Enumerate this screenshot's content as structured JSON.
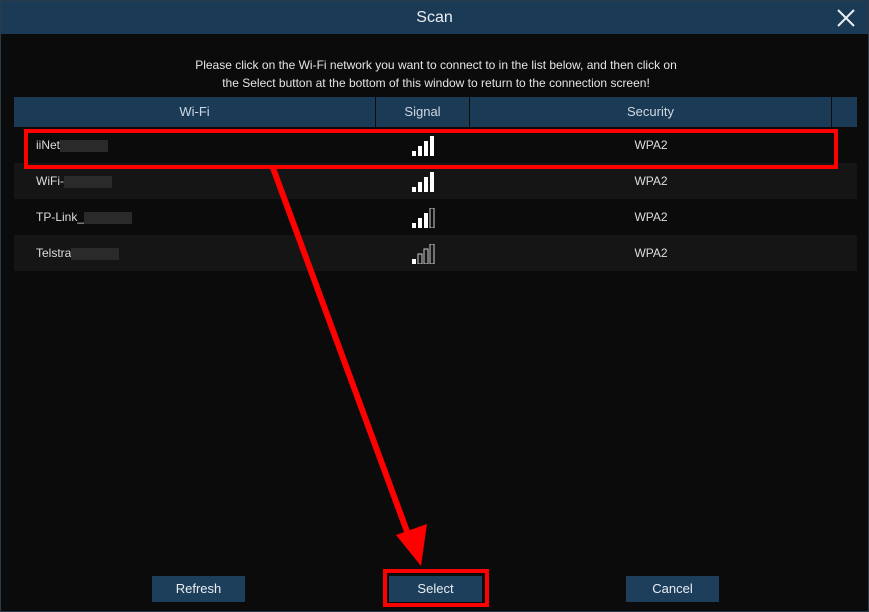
{
  "window": {
    "title": "Scan",
    "close_icon": "close-icon"
  },
  "instructions": {
    "line1": "Please click on the Wi-Fi network you want to connect to in the list below, and then click on",
    "line2": "the Select button at the bottom of this window to return to the connection screen!"
  },
  "table": {
    "columns": [
      "Wi-Fi",
      "Signal",
      "Security"
    ],
    "rows": [
      {
        "name": "iiNet",
        "signal": 4,
        "security": "WPA2"
      },
      {
        "name": "WiFi-",
        "signal": 4,
        "security": "WPA2"
      },
      {
        "name": "TP-Link_",
        "signal": 3,
        "security": "WPA2"
      },
      {
        "name": "Telstra",
        "signal": 1,
        "security": "WPA2"
      }
    ]
  },
  "buttons": {
    "refresh": "Refresh",
    "select": "Select",
    "cancel": "Cancel"
  },
  "colors": {
    "header_bg": "#1b3a55",
    "button_bg": "#1e3f5c",
    "annotation": "#ff0000"
  }
}
